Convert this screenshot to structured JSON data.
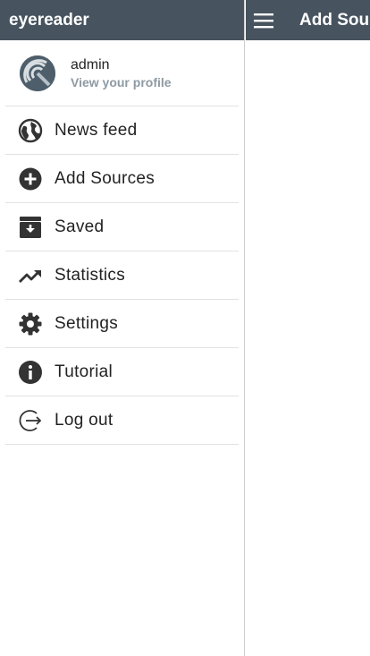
{
  "app": {
    "title": "eyereader"
  },
  "profile": {
    "name": "admin",
    "link": "View your profile"
  },
  "menu": [
    {
      "label": "News feed",
      "icon": "globe-icon"
    },
    {
      "label": "Add Sources",
      "icon": "add-circle-icon"
    },
    {
      "label": "Saved",
      "icon": "archive-icon"
    },
    {
      "label": "Statistics",
      "icon": "trending-up-icon"
    },
    {
      "label": "Settings",
      "icon": "gear-icon"
    },
    {
      "label": "Tutorial",
      "icon": "info-icon"
    },
    {
      "label": "Log out",
      "icon": "logout-icon"
    }
  ],
  "topbar": {
    "title": "Add Sou",
    "menu_icon": "hamburger-icon"
  },
  "colors": {
    "header": "#47545f",
    "link": "#8e9aa3"
  }
}
